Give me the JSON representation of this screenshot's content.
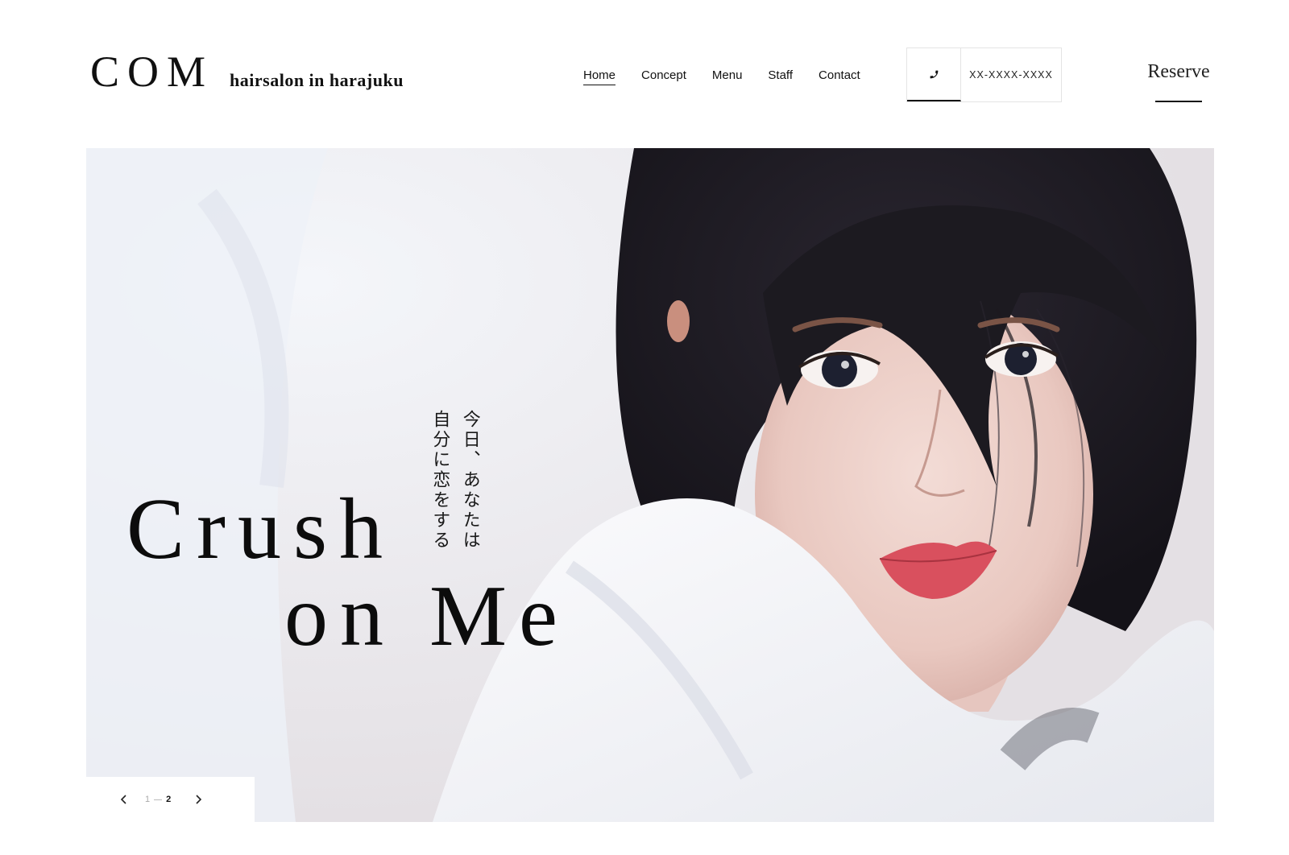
{
  "header": {
    "logo": "COM",
    "tagline": "hairsalon in harajuku",
    "nav": [
      {
        "label": "Home",
        "active": true
      },
      {
        "label": "Concept",
        "active": false
      },
      {
        "label": "Menu",
        "active": false
      },
      {
        "label": "Staff",
        "active": false
      },
      {
        "label": "Contact",
        "active": false
      }
    ],
    "phone_icon": "phone-icon",
    "phone_number": "XX-XXXX-XXXX",
    "reserve_label": "Reserve"
  },
  "hero": {
    "headline_line1": "Crush",
    "headline_line2": "on Me",
    "jp_copy_line1": "今日、あなたは",
    "jp_copy_line2": "自分に恋をする",
    "slider": {
      "prev_icon": "chevron-left-icon",
      "next_icon": "chevron-right-icon",
      "page_inactive": "1",
      "page_active": "2"
    }
  },
  "colors": {
    "text": "#111111",
    "background": "#ffffff",
    "border": "#e4e4e4",
    "lip_accent": "#d9505e"
  }
}
